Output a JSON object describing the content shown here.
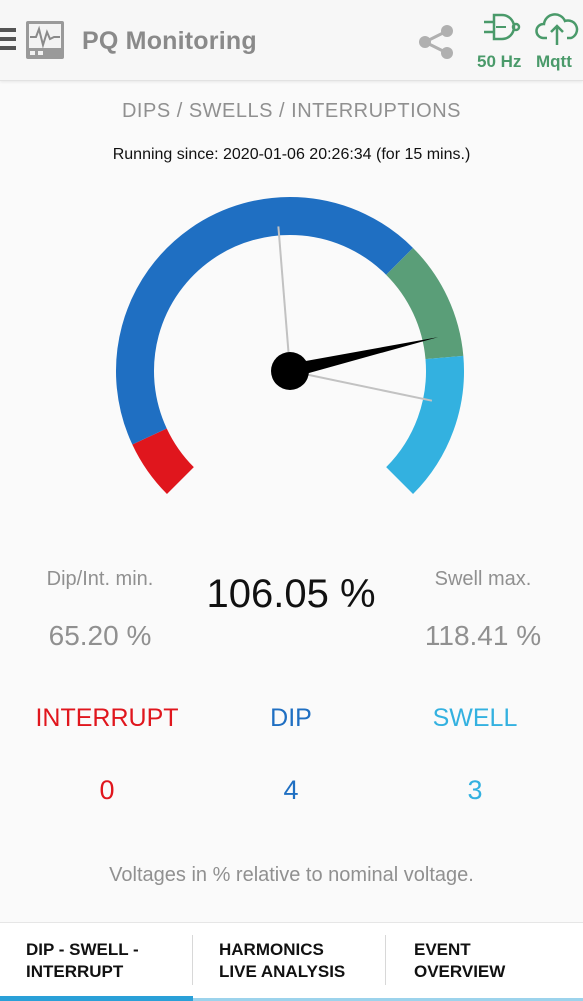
{
  "app": {
    "title": "PQ Monitoring",
    "frequency": "50 Hz",
    "mqtt": "Mqtt"
  },
  "icons": {
    "menu": "menu-icon",
    "logo": "pq-waveform-logo-icon",
    "share": "share-icon",
    "frequency": "logic-gate-icon",
    "cloud": "cloud-upload-icon"
  },
  "colors": {
    "interrupt": "#e0161d",
    "dip": "#1f6fc2",
    "normal": "#5a9e78",
    "swell": "#33b1e0",
    "accent": "#4a9a6a",
    "tab_indicator": "#2aa0d8"
  },
  "section": {
    "title": "DIPS / SWELLS / INTERRUPTIONS",
    "running_since": "Running since: 2020-01-06 20:26:34 (for 15 mins.)"
  },
  "gauge": {
    "current_percent": 106.05,
    "min_marker_percent": 65.2,
    "max_marker_percent": 118.41
  },
  "readings": {
    "dip_min_label": "Dip/Int. min.",
    "dip_min_value": "65.20 %",
    "current_value": "106.05 %",
    "swell_max_label": "Swell max.",
    "swell_max_value": "118.41 %"
  },
  "counts": {
    "interrupt_label": "INTERRUPT",
    "interrupt_count": "0",
    "dip_label": "DIP",
    "dip_count": "4",
    "swell_label": "SWELL",
    "swell_count": "3"
  },
  "note": "Voltages in % relative to nominal voltage.",
  "tabs": [
    {
      "line1": "DIP - SWELL -",
      "line2": "INTERRUPT",
      "active": true
    },
    {
      "line1": "HARMONICS",
      "line2": "LIVE ANALYSIS",
      "active": false
    },
    {
      "line1": "EVENT",
      "line2": "OVERVIEW",
      "active": false
    }
  ]
}
